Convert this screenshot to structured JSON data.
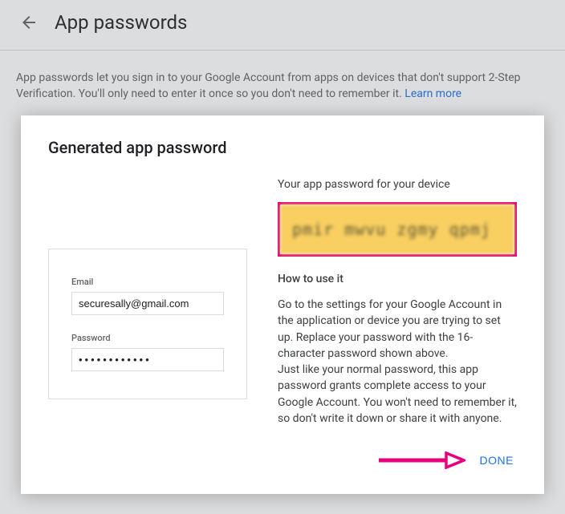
{
  "header": {
    "title": "App passwords"
  },
  "description": {
    "text": "App passwords let you sign in to your Google Account from apps on devices that don't support 2-Step Verification. You'll only need to enter it once so you don't need to remember it. ",
    "learn_more": "Learn more"
  },
  "modal": {
    "title": "Generated app password",
    "device_card": {
      "email_label": "Email",
      "email_value": "securesally@gmail.com",
      "password_label": "Password",
      "password_value": "••••••••••••"
    },
    "right": {
      "password_heading": "Your app password for your device",
      "generated_password": "pmir mwvu zgmy qpmj",
      "howto_title": "How to use it",
      "howto_text": "Go to the settings for your Google Account in the application or device you are trying to set up. Replace your password with the 16-character password shown above.\nJust like your normal password, this app password grants complete access to your Google Account. You won't need to remember it, so don't write it down or share it with anyone."
    },
    "done_label": "DONE"
  }
}
